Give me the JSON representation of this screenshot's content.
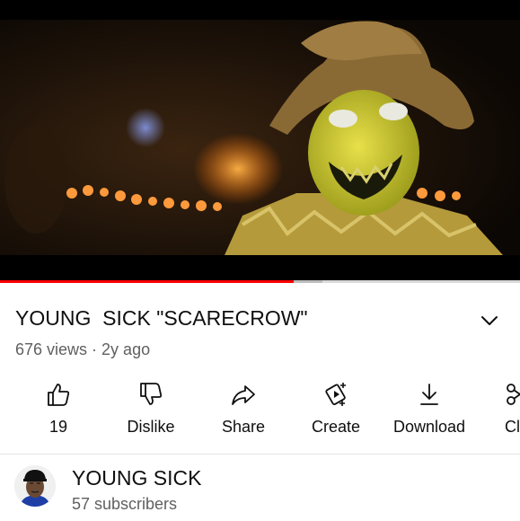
{
  "video": {
    "progress_played": 0.565,
    "progress_buffered": 0.62
  },
  "video_info": {
    "title": "YOUNG  SICK \"SCARECROW\"",
    "views": "676 views",
    "separator": "·",
    "age": "2y ago"
  },
  "actions": [
    {
      "name": "like",
      "icon": "thumbs-up-icon",
      "label": "19"
    },
    {
      "name": "dislike",
      "icon": "thumbs-down-icon",
      "label": "Dislike"
    },
    {
      "name": "share",
      "icon": "share-icon",
      "label": "Share"
    },
    {
      "name": "create",
      "icon": "create-sparkle-icon",
      "label": "Create"
    },
    {
      "name": "download",
      "icon": "download-icon",
      "label": "Download"
    },
    {
      "name": "clip",
      "icon": "scissors-icon",
      "label": "Cl"
    }
  ],
  "channel": {
    "name": "YOUNG SICK",
    "subscribers": "57 subscribers"
  },
  "colors": {
    "progress": "#ff0000",
    "text_primary": "#0f0f0f",
    "text_secondary": "#606060"
  }
}
